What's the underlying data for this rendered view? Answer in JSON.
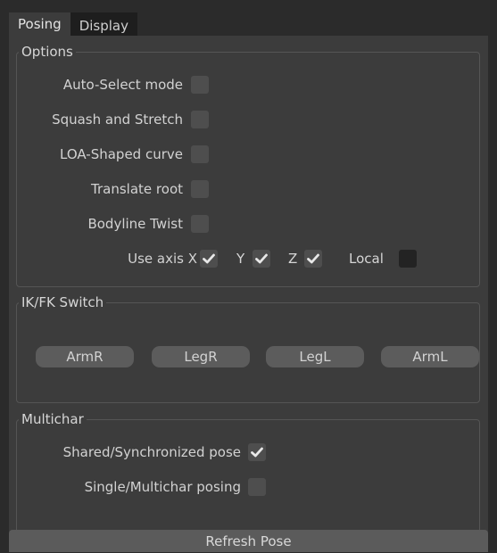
{
  "tabs": [
    "Posing",
    "Display"
  ],
  "options": {
    "title": "Options",
    "items": [
      {
        "label": "Auto-Select mode",
        "checked": false
      },
      {
        "label": "Squash and Stretch",
        "checked": false
      },
      {
        "label": "LOA-Shaped curve",
        "checked": false
      },
      {
        "label": "Translate root",
        "checked": false
      },
      {
        "label": "Bodyline Twist",
        "checked": false
      }
    ],
    "axis": {
      "label": "Use axis X",
      "x_checked": true,
      "y_label": "Y",
      "y_checked": true,
      "z_label": "Z",
      "z_checked": true,
      "local_label": "Local",
      "local_checked": false
    }
  },
  "ikfk": {
    "title": "IK/FK Switch",
    "buttons": [
      "ArmR",
      "LegR",
      "LegL",
      "ArmL"
    ]
  },
  "multichar": {
    "title": "Multichar",
    "items": [
      {
        "label": "Shared/Synchronized pose",
        "checked": true
      },
      {
        "label": "Single/Multichar posing",
        "checked": false
      }
    ]
  },
  "refresh_label": "Refresh Pose",
  "colors": {
    "check": "#e8e8e8",
    "panel": "#3c3c3c",
    "checkbox": "#4e4e4e"
  }
}
